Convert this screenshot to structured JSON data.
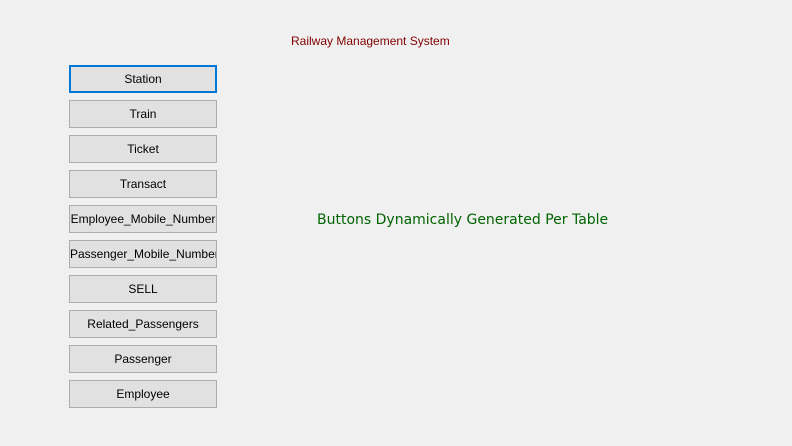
{
  "form": {
    "title": "Railway Management System"
  },
  "table_buttons": [
    {
      "label": "Station",
      "focused": true
    },
    {
      "label": "Train",
      "focused": false
    },
    {
      "label": "Ticket",
      "focused": false
    },
    {
      "label": "Transact",
      "focused": false
    },
    {
      "label": "Employee_Mobile_Number",
      "focused": false
    },
    {
      "label": "Passenger_Mobile_Number",
      "focused": false
    },
    {
      "label": "SELL",
      "focused": false
    },
    {
      "label": "Related_Passengers",
      "focused": false
    },
    {
      "label": "Passenger",
      "focused": false
    },
    {
      "label": "Employee",
      "focused": false
    }
  ],
  "info_label": "Buttons Dynamically Generated Per Table",
  "colors": {
    "background": "#f0f0f0",
    "title_text": "#800000",
    "info_text": "#006400",
    "button_face": "#e1e1e1",
    "button_border": "#adadad",
    "focus_border": "#0078d7"
  }
}
